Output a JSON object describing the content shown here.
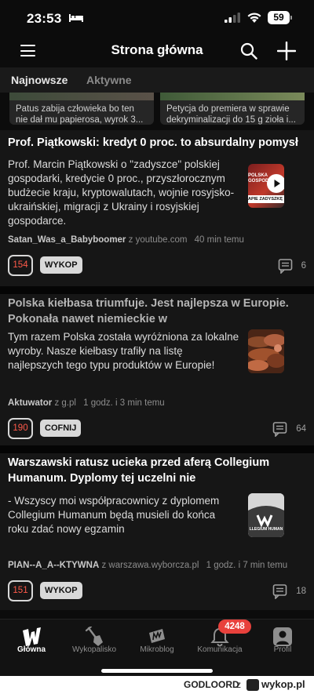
{
  "status": {
    "time": "23:53",
    "battery": "59"
  },
  "header": {
    "title": "Strona główna"
  },
  "tabs": [
    {
      "label": "Najnowsze"
    },
    {
      "label": "Aktywne"
    }
  ],
  "carousel": [
    {
      "text": "Patus zabija człowieka bo ten\nnie dał mu papierosa, wyrok 3..."
    },
    {
      "text": "Petycja do premiera w sprawie\ndekryminalizacji do 15 g zioła i..."
    }
  ],
  "entries": [
    {
      "title": "Prof. Piątkowski: kredyt 0 proc. to absurdalny pomysł",
      "description": [
        "Prof. Marcin Piątkowski o \"zadyszce\" polskiej",
        "gospodarki, kredycie 0 proc., przyszłorocznym",
        "budżecie kraju, kryptowalutach, wojnie rosyjsko-",
        "ukraińskiej, migracji z Ukrainy i rosyjskiej",
        "gospodarce."
      ],
      "thumb_text": [
        "POLSKA",
        "GOSPODA",
        "APIE ZADYSZKĘ"
      ],
      "author": "Satan_Was_a_Babyboomer",
      "source": "z youtube.com",
      "time": "40 min temu",
      "votes": "154",
      "vote_button": "WYKOP",
      "comments": "6"
    },
    {
      "title": "Polska kiełbasa triumfuje. Jest najlepsza w Europie. Pokonała nawet niemieckie w",
      "title_lines": [
        "Polska kiełbasa triumfuje. Jest najlepsza w Europie.",
        "Pokonała nawet niemieckie w"
      ],
      "description": [
        "Tym razem Polska została wyróżniona za lokalne",
        "wyroby. Nasze kiełbasy trafiły na listę",
        "najlepszych tego typu produktów w Europie!"
      ],
      "author": "Aktuwator",
      "source": "z g.pl",
      "time": "1 godz. i 3 min temu",
      "votes": "190",
      "vote_button": "COFNIJ",
      "comments": "64"
    },
    {
      "title_lines": [
        "Warszawski ratusz ucieka przed aferą Collegium",
        "Humanum. Dyplomy tej uczelni nie"
      ],
      "description": [
        "- Wszyscy moi współpracownicy z dyplomem",
        "Collegium Humanum będą musieli do końca",
        "roku zdać nowy egzamin"
      ],
      "thumb_text": [
        "LLEGIUM HUMAN"
      ],
      "author": "PIAN--A_A--KTYWNA",
      "source": "z warszawa.wyborcza.pl",
      "time": "1 godz. i 7 min temu",
      "votes": "151",
      "vote_button": "WYKOP",
      "comments": "18"
    }
  ],
  "nav": [
    {
      "label": "Główna",
      "icon": "wykop-logo-icon"
    },
    {
      "label": "Wykopalisko",
      "icon": "shovel-icon"
    },
    {
      "label": "Mikroblog",
      "icon": "mikroblog-icon"
    },
    {
      "label": "Komunikacja",
      "icon": "bell-icon"
    },
    {
      "label": "Profil",
      "icon": "profile-icon"
    }
  ],
  "notifications_badge": "4248",
  "watermark": {
    "user": "GODLOORD",
    "z": "z",
    "site": "wykop.pl"
  },
  "colors": {
    "background": "#0c0c0c",
    "card": "#161616",
    "vote_count": "#ff5a4a",
    "badge": "#e8413c"
  }
}
